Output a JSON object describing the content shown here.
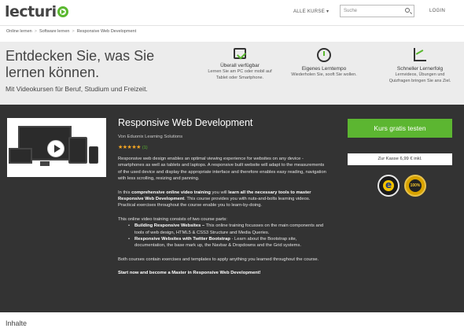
{
  "header": {
    "logo_text": "lecturi",
    "all_courses": "ALLE KURSE ▾",
    "search_placeholder": "Suche",
    "login": "LOGIN"
  },
  "breadcrumb": [
    "Online lernen",
    "Software lernen",
    "Responsive Web Development"
  ],
  "hero": {
    "title": "Entdecken Sie, was Sie lernen können.",
    "subtitle": "Mit Videokursen für Beruf, Studium und Freizeit.",
    "features": [
      {
        "title": "Überall verfügbar",
        "text": "Lernen Sie am PC oder mobil auf Tablet oder Smartphone.",
        "icon": "tablet-check-icon"
      },
      {
        "title": "Eigenes Lerntempo",
        "text": "Wiederholen Sie, sooft Sie wollen.",
        "icon": "stopwatch-icon"
      },
      {
        "title": "Schneller Lernerfolg",
        "text": "Lernvideos, Übungen und Quizfragen bringen Sie ans Ziel.",
        "icon": "chart-icon"
      }
    ]
  },
  "course": {
    "title": "Responsive Web Development",
    "author": "Von Eduonix Learning Solutions",
    "stars": "★★★★★",
    "rating_count": "(1)",
    "description": {
      "p1": "Responsive web design enables an optimal viewing experience for websites on any device - smartphones as well as tablets and laptops. A responsive built website will adapt to the measurements of the used device and display the appropriate interface and therefore enables easy reading, navigation with less scrolling, resizing and panning.",
      "p2_pre": "In this ",
      "p2_bold": "comprehensive online video training",
      "p2_mid": " you will ",
      "p2_bold2": "learn all the necessary tools to master Responsive Web Development",
      "p2_post": ". This course provides you with nuts-and-bolts learning videos. Practical exercises throughout the course enable you to learn-by-doing.",
      "p3": "This online video training consists of two course parts:",
      "bullets": [
        {
          "bold": "Building Responsive Websites –",
          "text": " This online training focusses on the main components and tools of web design, HTML5 & CSS3 Structure and Media Queries."
        },
        {
          "bold": "Responsive Websites with Twitter Bootstrap",
          "text": " - Learn about the Bootstrap site, documentation, the base mark up, the Navbar & Dropdowns and the Grid systems."
        }
      ],
      "p4": "Both courses contain exercises and templates to apply anything you learned throughout the course.",
      "p5": "Start now and become a Master in Responsive Web Development!"
    },
    "cta": "Kurs gratis testen",
    "cart": "Zur Kasse 6,99 € inkl.",
    "badge2_text": "100% GELD ZURÜCK"
  },
  "section_heading": "Inhalte",
  "colors": {
    "accent": "#5cb631",
    "dark_panel": "#333333",
    "hero_bg": "#ececec",
    "stars": "#f5a623"
  }
}
